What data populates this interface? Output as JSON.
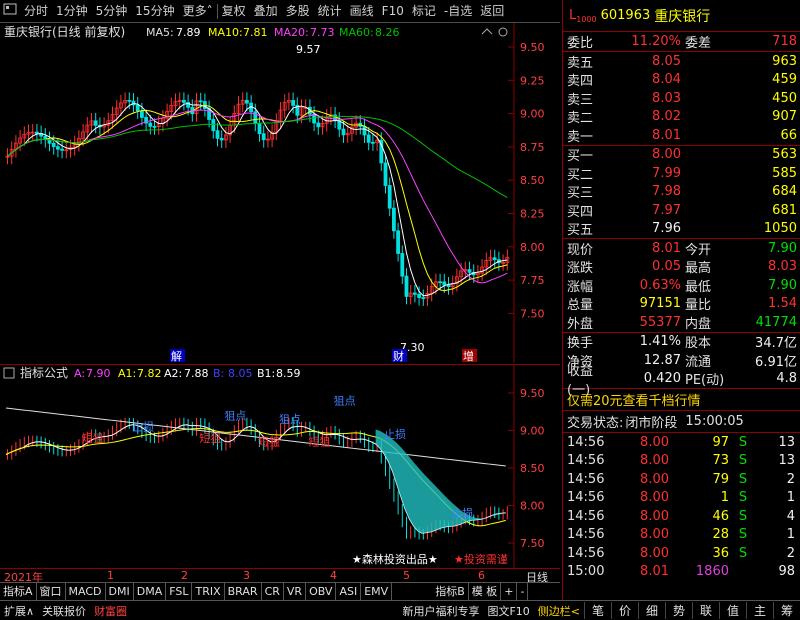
{
  "toolbar": {
    "items": [
      "分时",
      "1分钟",
      "5分钟",
      "15分钟",
      "更多",
      "复权",
      "叠加",
      "多股",
      "统计",
      "画线",
      "F10",
      "标记",
      "-自选",
      "返回"
    ]
  },
  "chart_a": {
    "title": "重庆银行(日线 前复权)",
    "ma5_label": "MA5:",
    "ma5": "7.89",
    "ma10_label": "MA10:",
    "ma10": "7.81",
    "ma20_label": "MA20:",
    "ma20": "7.73",
    "ma60_label": "MA60:",
    "ma60": "8.26",
    "high_label": "9.57",
    "low_label": "7.30",
    "axis": [
      "9.50",
      "9.25",
      "9.00",
      "8.75",
      "8.50",
      "8.25",
      "8.00",
      "7.75",
      "7.50"
    ],
    "markers": [
      "解",
      "财",
      "增"
    ]
  },
  "chart_b": {
    "title": "指标公式",
    "a_label": "A:",
    "a": "7.90",
    "a1_label": "A1:",
    "a1": "7.82",
    "a2_label": "A2:",
    "a2": "7.88",
    "b_label": "B:",
    "b": "8.05",
    "b1_label": "B1:",
    "b1": "8.59",
    "axis": [
      "9.50",
      "9.00",
      "8.50",
      "8.00",
      "7.50"
    ],
    "tags": {
      "short": "短狙",
      "rebound": "反弹",
      "point": "狙点",
      "stop": "止损",
      "risk": "风控",
      "highbuy": "高拋",
      "pick": "★森林投资出品★",
      "invest": "★投资需谨"
    }
  },
  "xaxis": {
    "labels": [
      "2021年",
      "1",
      "2",
      "3",
      "4",
      "5",
      "6"
    ],
    "unit": "日线"
  },
  "tabs": [
    "指标A",
    "窗口",
    "MACD",
    "DMI",
    "DMA",
    "FSL",
    "TRIX",
    "BRAR",
    "CR",
    "VR",
    "OBV",
    "ASI",
    "EMV",
    "指标B",
    "模 板",
    "+",
    "-"
  ],
  "quote": {
    "flag": "L",
    "flag_sub": "1000",
    "code": "601963",
    "name": "重庆银行",
    "weibi_label": "委比",
    "weibi": "11.20%",
    "weicha_label": "委差",
    "weicha": "718",
    "asks": [
      {
        "l": "卖五",
        "p": "8.05",
        "v": "963"
      },
      {
        "l": "卖四",
        "p": "8.04",
        "v": "459"
      },
      {
        "l": "卖三",
        "p": "8.03",
        "v": "450"
      },
      {
        "l": "卖二",
        "p": "8.02",
        "v": "907"
      },
      {
        "l": "卖一",
        "p": "8.01",
        "v": "66"
      }
    ],
    "bids": [
      {
        "l": "买一",
        "p": "8.00",
        "v": "563"
      },
      {
        "l": "买二",
        "p": "7.99",
        "v": "585"
      },
      {
        "l": "买三",
        "p": "7.98",
        "v": "684"
      },
      {
        "l": "买四",
        "p": "7.97",
        "v": "681"
      },
      {
        "l": "买五",
        "p": "7.96",
        "v": "1050"
      }
    ],
    "stats": [
      [
        "现价",
        "8.01",
        "今开",
        "7.90"
      ],
      [
        "涨跌",
        "0.05",
        "最高",
        "8.03"
      ],
      [
        "涨幅",
        "0.63%",
        "最低",
        "7.90"
      ],
      [
        "总量",
        "97151",
        "量比",
        "1.54"
      ],
      [
        "外盘",
        "55377",
        "内盘",
        "41774"
      ]
    ],
    "stats2": [
      [
        "换手",
        "1.41%",
        "股本",
        "34.7亿"
      ],
      [
        "净资",
        "12.87",
        "流通",
        "6.91亿"
      ],
      [
        "收益(一)",
        "0.420",
        "PE(动)",
        "4.8"
      ]
    ],
    "promo": "仅需20元查看千档行情",
    "status_label": "交易状态:",
    "status": "闭市阶段",
    "status_time": "15:00:05",
    "ticks": [
      [
        "14:56",
        "8.00",
        "97",
        "S",
        "13"
      ],
      [
        "14:56",
        "8.00",
        "73",
        "S",
        "13"
      ],
      [
        "14:56",
        "8.00",
        "79",
        "S",
        "2"
      ],
      [
        "14:56",
        "8.00",
        "1",
        "S",
        "1"
      ],
      [
        "14:56",
        "8.00",
        "46",
        "S",
        "4"
      ],
      [
        "14:56",
        "8.00",
        "28",
        "S",
        "1"
      ],
      [
        "14:56",
        "8.00",
        "36",
        "S",
        "2"
      ],
      [
        "15:00",
        "8.01",
        "1860",
        "",
        "98"
      ]
    ]
  },
  "bottom": {
    "left": [
      "扩展∧",
      "关联报价",
      "财富圈"
    ],
    "mid": [
      "新用户福利专享",
      "图文F10",
      "侧边栏<"
    ],
    "right": [
      "笔",
      "价",
      "细",
      "势",
      "联",
      "值",
      "主",
      "筹"
    ]
  },
  "colors": {
    "up": "#ff3030",
    "down": "#00e000",
    "ma5": "#ffffff",
    "ma10": "#ffff00",
    "ma20": "#ff40ff",
    "ma60": "#00c000"
  }
}
